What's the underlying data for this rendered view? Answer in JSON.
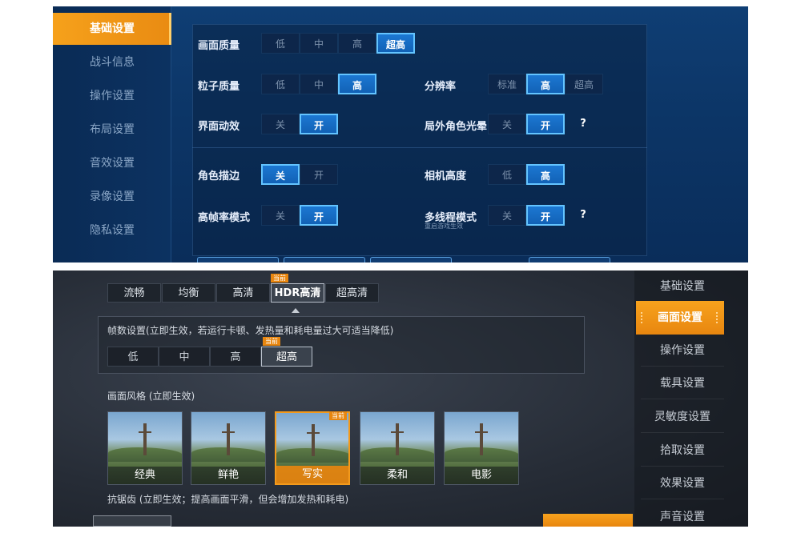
{
  "top_panel": {
    "nav_items": [
      {
        "label": "基础设置",
        "active": true
      },
      {
        "label": "战斗信息"
      },
      {
        "label": "操作设置"
      },
      {
        "label": "布局设置"
      },
      {
        "label": "音效设置"
      },
      {
        "label": "录像设置"
      },
      {
        "label": "隐私设置"
      }
    ],
    "settings": {
      "image_quality": {
        "label": "画面质量",
        "options": [
          "低",
          "中",
          "高",
          "超高"
        ],
        "selected": "超高"
      },
      "particle_quality": {
        "label": "粒子质量",
        "options": [
          "低",
          "中",
          "高"
        ],
        "selected": "高"
      },
      "resolution": {
        "label": "分辨率",
        "options": [
          "标准",
          "高",
          "超高"
        ],
        "selected": "高"
      },
      "ui_animation": {
        "label": "界面动效",
        "options": [
          "关",
          "开"
        ],
        "selected": "开"
      },
      "outside_glow": {
        "label": "局外角色光晕",
        "options": [
          "关",
          "开"
        ],
        "selected": "开",
        "help": "?"
      },
      "outline": {
        "label": "角色描边",
        "options": [
          "关",
          "开"
        ],
        "selected": "关"
      },
      "camera_height": {
        "label": "相机高度",
        "options": [
          "低",
          "高"
        ],
        "selected": "高"
      },
      "high_fps": {
        "label": "高帧率模式",
        "options": [
          "关",
          "开"
        ],
        "selected": "开"
      },
      "multithread": {
        "label": "多线程模式",
        "sublabel": "重启游戏生效",
        "options": [
          "关",
          "开"
        ],
        "selected": "开",
        "help": "?"
      }
    }
  },
  "bottom_panel": {
    "quality_tabs": [
      {
        "label": "流畅"
      },
      {
        "label": "均衡"
      },
      {
        "label": "高清"
      },
      {
        "label": "HDR高清",
        "selected": true,
        "badge": "当前"
      },
      {
        "label": "超高清"
      }
    ],
    "fps": {
      "title": "帧数设置(立即生效，若运行卡顿、发热量和耗电量过大可适当降低)",
      "options": [
        "低",
        "中",
        "高",
        "超高"
      ],
      "selected": "超高",
      "badge": "当前"
    },
    "style": {
      "title": "画面风格 (立即生效)",
      "items": [
        {
          "label": "经典"
        },
        {
          "label": "鲜艳"
        },
        {
          "label": "写实",
          "selected": true,
          "badge": "当前"
        },
        {
          "label": "柔和"
        },
        {
          "label": "电影"
        }
      ]
    },
    "anti_alias": {
      "title": "抗锯齿 (立即生效；提高画面平滑，但会增加发热和耗电)"
    },
    "right_nav": [
      {
        "label": "基础设置"
      },
      {
        "label": "画面设置",
        "active": true
      },
      {
        "label": "操作设置"
      },
      {
        "label": "载具设置"
      },
      {
        "label": "灵敏度设置"
      },
      {
        "label": "拾取设置"
      },
      {
        "label": "效果设置"
      },
      {
        "label": "声音设置"
      }
    ]
  },
  "colors": {
    "accent_orange": "#f39a1c",
    "accent_blue": "#1c78d2"
  }
}
